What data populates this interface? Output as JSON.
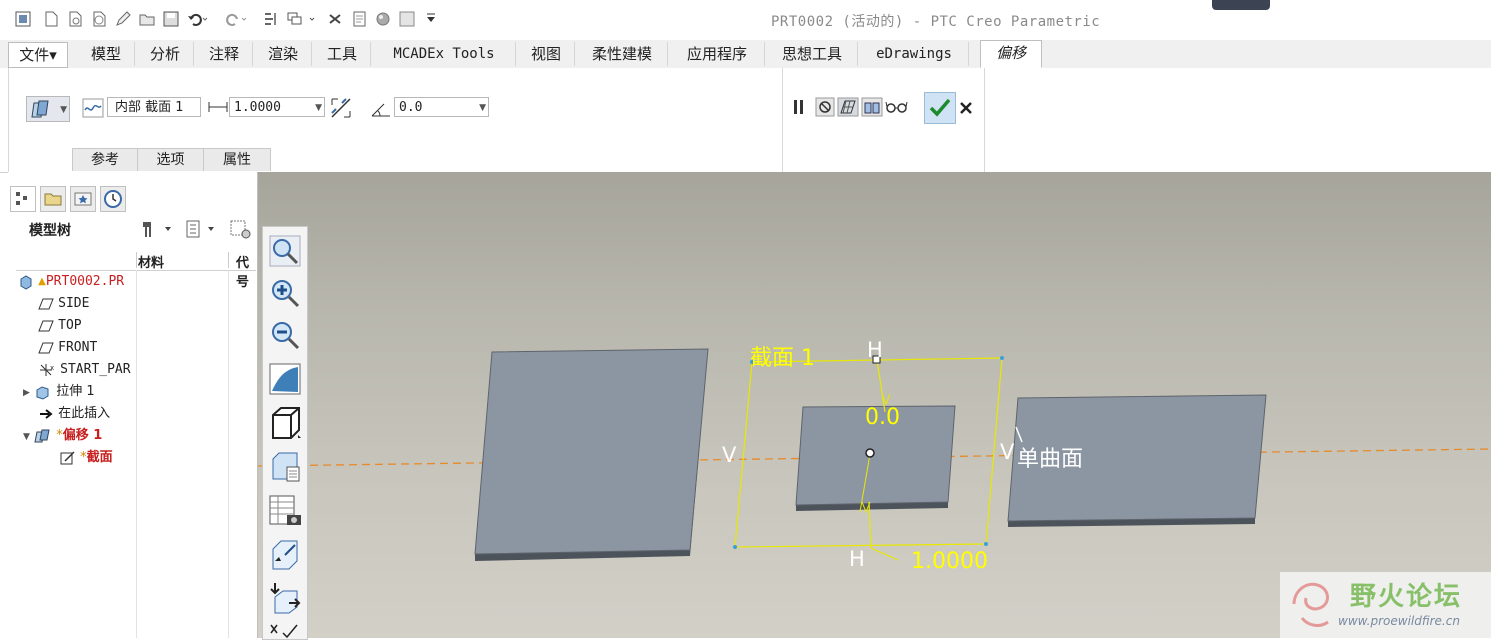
{
  "window": {
    "title": "PRT0002 (活动的) - PTC Creo Parametric"
  },
  "tabs": [
    {
      "label": "文件▾"
    },
    {
      "label": "模型"
    },
    {
      "label": "分析"
    },
    {
      "label": "注释"
    },
    {
      "label": "渲染"
    },
    {
      "label": "工具"
    },
    {
      "label": "MCADEx Tools"
    },
    {
      "label": "视图"
    },
    {
      "label": "柔性建模"
    },
    {
      "label": "应用程序"
    },
    {
      "label": "思想工具"
    },
    {
      "label": "eDrawings"
    },
    {
      "label": "偏移"
    }
  ],
  "ribbon": {
    "sketch_ref": "内部 截面 1",
    "offset_value": "1.0000",
    "angle_value": "0.0",
    "subtabs": [
      "参考",
      "选项",
      "属性"
    ]
  },
  "model_tree": {
    "title": "模型树",
    "columns": [
      "材料",
      "代号"
    ],
    "items": [
      {
        "label": "PRT0002.PR"
      },
      {
        "label": "SIDE"
      },
      {
        "label": "TOP"
      },
      {
        "label": "FRONT"
      },
      {
        "label": "START_PAR"
      },
      {
        "label": "拉伸 1"
      },
      {
        "label": "在此插入"
      },
      {
        "label": "偏移 1"
      },
      {
        "label": "截面"
      }
    ]
  },
  "viewport": {
    "section_label": "截面 1",
    "angle_dim": "0.0",
    "offset_dim": "1.0000",
    "h_top": "H",
    "h_bottom": "H",
    "v_left": "V",
    "v_right": "V",
    "surface_label": "单曲面"
  },
  "watermark": {
    "name": "野火论坛",
    "url": "www.proewildfire.cn"
  },
  "colors": {
    "accent": "#ffff00",
    "plate": "#8e98a5",
    "edge": "#4b5158"
  }
}
